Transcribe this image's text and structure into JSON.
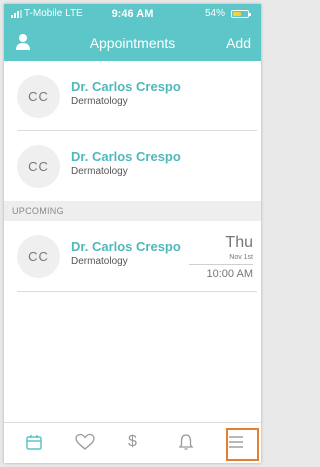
{
  "status_bar": {
    "carrier": "T-Mobile  LTE",
    "time": "9:46 AM",
    "battery": "54%",
    "battery_level": 0.54
  },
  "header": {
    "title": "Appointments",
    "add_label": "Add"
  },
  "appointments": [
    {
      "initials": "CC",
      "name": "Dr. Carlos Crespo",
      "specialty": "Dermatology"
    },
    {
      "initials": "CC",
      "name": "Dr. Carlos Crespo",
      "specialty": "Dermatology"
    }
  ],
  "upcoming": {
    "section_label": "UPCOMING",
    "items": [
      {
        "initials": "CC",
        "name": "Dr. Carlos Crespo",
        "specialty": "Dermatology",
        "day": "Thu",
        "date": "Nov 1st",
        "time": "10:00 AM"
      }
    ]
  },
  "tab_bar": {
    "tabs": [
      "calendar-icon",
      "heart-icon",
      "dollar-icon",
      "bell-icon",
      "menu-icon"
    ],
    "dollar_symbol": "$",
    "highlight_color": "#e67e2e"
  },
  "colors": {
    "accent": "#5cc6c8",
    "name_text": "#4fb8bb"
  }
}
